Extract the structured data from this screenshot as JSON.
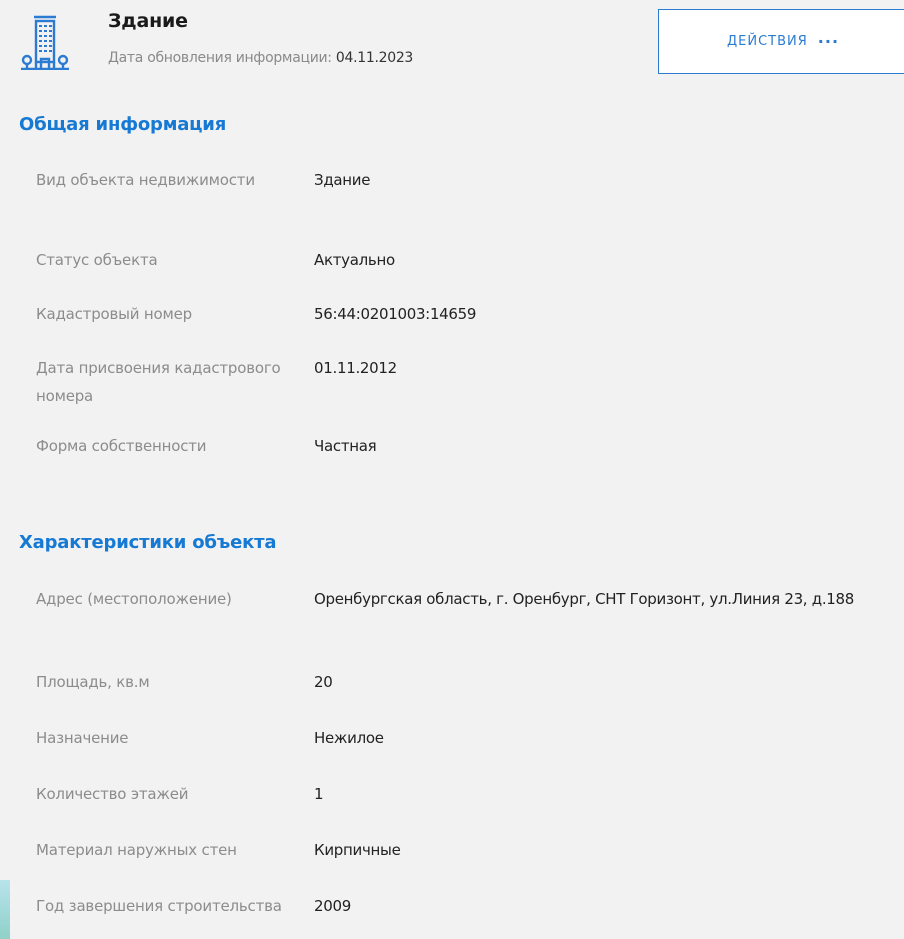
{
  "header": {
    "title": "Здание",
    "update_label": "Дата обновления информации: ",
    "update_date": "04.11.2023",
    "actions_label": "ДЕЙСТВИЯ",
    "actions_dots": "···"
  },
  "general": {
    "title": "Общая информация",
    "rows": [
      {
        "label": "Вид объекта недвижимости",
        "value": "Здание"
      },
      {
        "label": "Статус объекта",
        "value": "Актуально"
      },
      {
        "label": "Кадастровый номер",
        "value": "56:44:0201003:14659"
      },
      {
        "label": "Дата присвоения кадастрового номера",
        "value": "01.11.2012"
      },
      {
        "label": "Форма собственности",
        "value": "Частная"
      }
    ]
  },
  "characteristics": {
    "title": "Характеристики объекта",
    "rows": [
      {
        "label": "Адрес (местоположение)",
        "value": "Оренбургская область, г. Оренбург, СНТ Горизонт, ул.Линия 23, д.188"
      },
      {
        "label": "Площадь, кв.м",
        "value": "20"
      },
      {
        "label": "Назначение",
        "value": "Нежилое"
      },
      {
        "label": "Количество этажей",
        "value": "1"
      },
      {
        "label": "Материал наружных стен",
        "value": "Кирпичные"
      },
      {
        "label": "Год завершения строительства",
        "value": "2009"
      }
    ]
  },
  "colors": {
    "accent": "#1679d4",
    "icon": "#2b7bd3",
    "label": "#8c8c8c",
    "background": "#f2f2f2"
  },
  "icons": {
    "object": "building-icon"
  }
}
